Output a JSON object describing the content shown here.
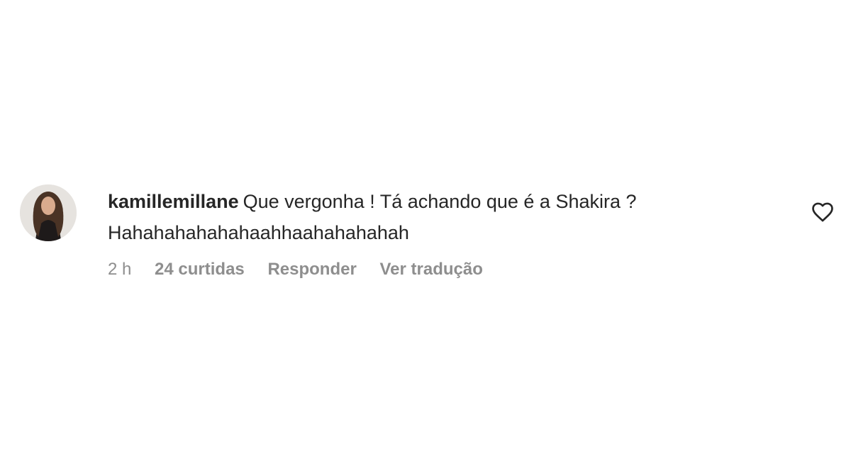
{
  "comment": {
    "username": "kamillemillane",
    "text_line1": "Que vergonha ! Tá achando que é a Shakira ?",
    "text_line2": "Hahahahahahahaahhaahahahahah",
    "time": "2 h",
    "likes": "24 curtidas",
    "reply_label": "Responder",
    "translate_label": "Ver tradução",
    "avatar_icon": "profile-photo",
    "like_icon": "heart-outline-icon"
  },
  "colors": {
    "text": "#262626",
    "secondary": "#8e8e8e",
    "background": "#ffffff"
  }
}
